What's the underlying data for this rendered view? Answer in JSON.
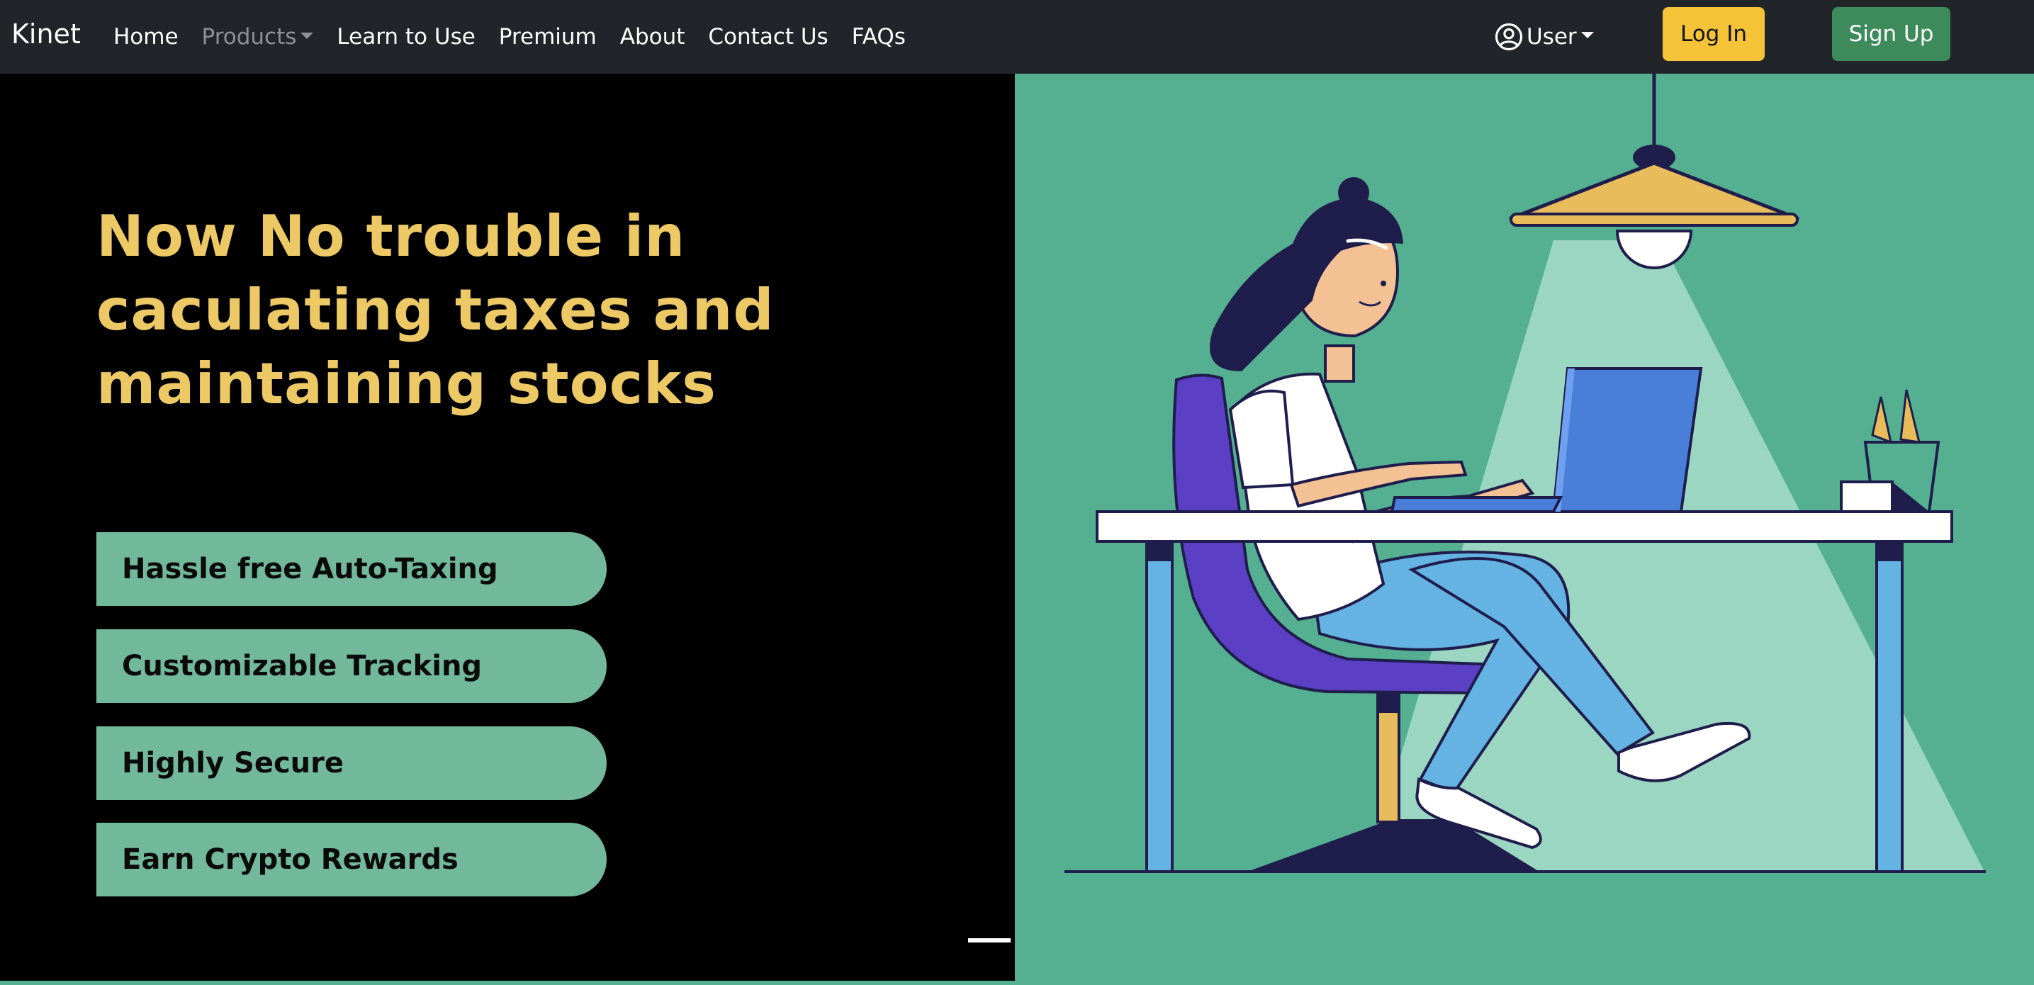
{
  "navbar": {
    "brand": "Kinet",
    "links": [
      "Home",
      "Products",
      "Learn to Use",
      "Premium",
      "About",
      "Contact Us",
      "FAQs"
    ],
    "user_label": "User",
    "login_label": "Log In",
    "signup_label": "Sign Up"
  },
  "hero": {
    "headline_lines": [
      "Now No trouble in",
      "caculating taxes and",
      "maintaining stocks"
    ],
    "features": [
      "Hassle free Auto-Taxing",
      "Customizable Tracking",
      "Highly Secure",
      "Earn Crypto Rewards"
    ],
    "carousel": {
      "slide_count": 2,
      "active_slide": 1
    }
  },
  "colors": {
    "navbar_bg": "#212529",
    "headline": "#ecc964",
    "feature_bg": "#72b99b",
    "illustration_bg": "#55b091",
    "login_button": "#f5c338",
    "signup_button": "#3d8a5b"
  },
  "icons": [
    "user-circle-icon",
    "chevron-down-icon"
  ]
}
